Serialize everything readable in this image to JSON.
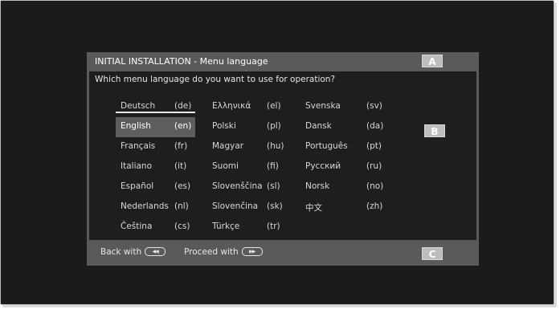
{
  "header": {
    "title": "INITIAL INSTALLATION - Menu language"
  },
  "prompt": "Which menu language do you want to use for operation?",
  "markers": {
    "a": "A",
    "b": "B",
    "c": "C"
  },
  "footer": {
    "back_label": "Back with",
    "back_icon": "rewind-icon",
    "proceed_label": "Proceed with",
    "proceed_icon": "fast-forward-icon"
  },
  "languages": [
    {
      "name": "Deutsch",
      "code": "(de)"
    },
    {
      "name": "English",
      "code": "(en)",
      "selected": true
    },
    {
      "name": "Français",
      "code": "(fr)"
    },
    {
      "name": "Italiano",
      "code": "(it)"
    },
    {
      "name": "Español",
      "code": "(es)"
    },
    {
      "name": "Nederlands",
      "code": "(nl)"
    },
    {
      "name": "Čeština",
      "code": "(cs)"
    },
    {
      "name": "Ελληνικά",
      "code": "(el)"
    },
    {
      "name": "Polski",
      "code": "(pl)"
    },
    {
      "name": "Magyar",
      "code": "(hu)"
    },
    {
      "name": "Suomi",
      "code": "(fi)"
    },
    {
      "name": "Slovenščina",
      "code": "(sl)"
    },
    {
      "name": "Slovenčina",
      "code": "(sk)"
    },
    {
      "name": "Türkçe",
      "code": "(tr)"
    },
    {
      "name": "Svenska",
      "code": "(sv)"
    },
    {
      "name": "Dansk",
      "code": "(da)"
    },
    {
      "name": "Português",
      "code": "(pt)"
    },
    {
      "name": "Русский",
      "code": "(ru)"
    },
    {
      "name": "Norsk",
      "code": "(no)"
    },
    {
      "name": "中文",
      "code": "(zh)"
    }
  ],
  "colors": {
    "panel": "#5a5a5a",
    "body": "#1e1e1e",
    "text": "#d8d8d8",
    "marker": "#bdbdbd"
  }
}
